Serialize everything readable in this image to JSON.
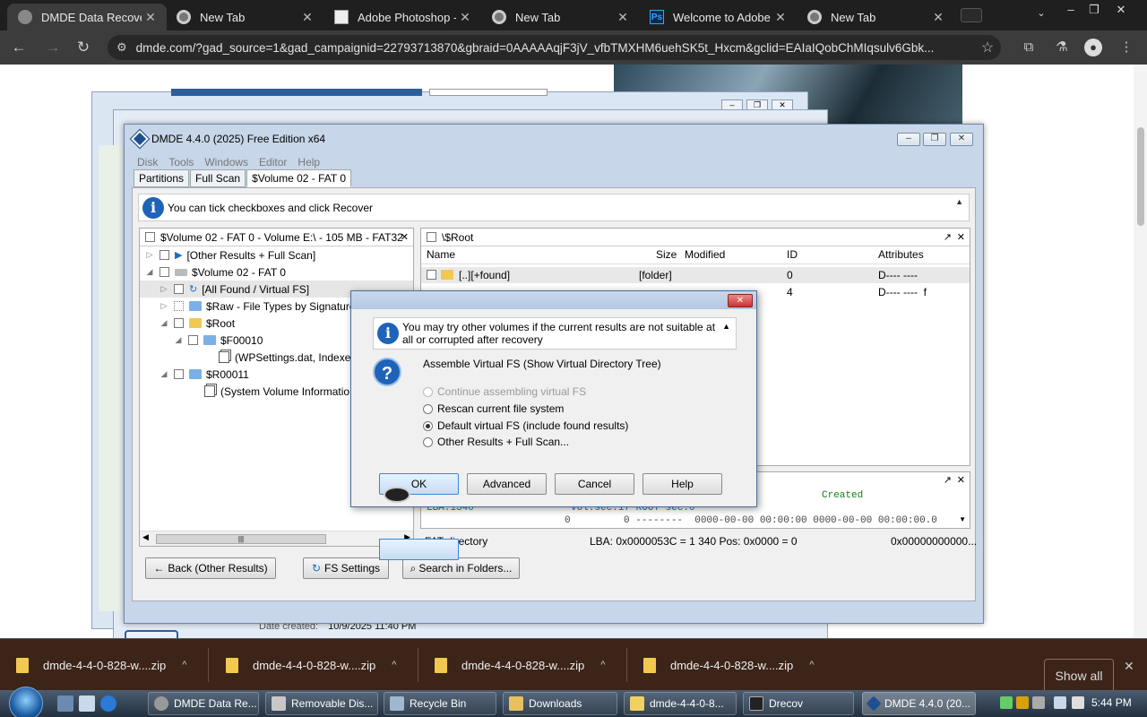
{
  "browser": {
    "tabs": [
      {
        "label": "DMDE Data Recovery",
        "icon": "dmde-icon",
        "active": true
      },
      {
        "label": "New Tab",
        "icon": "chrome-icon"
      },
      {
        "label": "Adobe Photoshop - ",
        "icon": "photoshop-icon"
      },
      {
        "label": "New Tab",
        "icon": "chrome-icon"
      },
      {
        "label": "Welcome to Adobe",
        "icon": "ps-icon",
        "icon_text": "Ps"
      },
      {
        "label": "New Tab",
        "icon": "chrome-icon"
      }
    ],
    "url": "dmde.com/?gad_source=1&gad_campaignid=22793713870&gbraid=0AAAAAqjF3jV_vfbTMXHM6uehSK5t_Hxcm&gclid=EAIaIQobChMIqsulv6Gbk..."
  },
  "page": {
    "date_created_label": "Date created:",
    "date_created_value": "10/9/2025 11:40 PM"
  },
  "dmde": {
    "title": "DMDE 4.4.0 (2025) Free Edition x64",
    "menu": [
      "Disk",
      "Tools",
      "Windows",
      "Editor",
      "Help"
    ],
    "tabs": [
      "Partitions",
      "Full Scan",
      "$Volume 02 - FAT 0"
    ],
    "info_text": "You can tick checkboxes and click Recover",
    "left_pane_title": "$Volume 02 - FAT 0 - Volume E:\\ - 105 MB - FAT32",
    "tree": [
      "[Other Results + Full Scan]",
      "$Volume 02 - FAT 0",
      "[All Found / Virtual FS]",
      "$Raw - File Types by Signature",
      "$Root",
      "$F00010",
      "(WPSettings.dat, Indexer",
      "$R00011",
      "(System Volume Informatio"
    ],
    "right_pane_title": "\\$Root",
    "columns": {
      "name": "Name",
      "size": "Size",
      "modified": "Modified",
      "id": "ID",
      "attributes": "Attributes"
    },
    "rows": [
      {
        "name": "[..][+found]",
        "size": "[folder]",
        "id": "0",
        "attr": "D---- ----"
      },
      {
        "name": "",
        "size": "",
        "id": "4",
        "attr": "D---- ----  f"
      }
    ],
    "lower_pane": {
      "created_label": "Created",
      "lba_line": "LBA:1340",
      "vol_line": "vol.sec:17 ROOT sec:0",
      "data_line": "0         0 --------  0000-00-00 00:00:00 0000-00-00 00:00:00.0"
    },
    "status": {
      "left": "FAT directory",
      "mid": "LBA: 0x0000053C = 1 340  Pos: 0x0000 = 0",
      "right": "0x00000000000..."
    },
    "buttons": {
      "back": "Back (Other Results)",
      "fs_settings": "FS Settings",
      "search": "Search in Folders..."
    }
  },
  "dialog": {
    "info_text": "You may try other volumes if the current results are not suitable at all or corrupted after recovery",
    "heading": "Assemble Virtual FS (Show Virtual Directory Tree)",
    "options": [
      {
        "label": "Continue assembling virtual FS",
        "disabled": true,
        "selected": false
      },
      {
        "label": "Rescan current file system",
        "disabled": false,
        "selected": false
      },
      {
        "label": "Default virtual FS (include found results)",
        "disabled": false,
        "selected": true
      },
      {
        "label": "Other Results + Full Scan...",
        "disabled": false,
        "selected": false
      }
    ],
    "buttons": {
      "ok": "OK",
      "advanced": "Advanced",
      "cancel": "Cancel",
      "help": "Help"
    }
  },
  "downloads": {
    "items": [
      "dmde-4-4-0-828-w....zip",
      "dmde-4-4-0-828-w....zip",
      "dmde-4-4-0-828-w....zip",
      "dmde-4-4-0-828-w....zip"
    ],
    "show_all": "Show all"
  },
  "taskbar": {
    "tasks": [
      "DMDE Data Re...",
      "Removable Dis...",
      "Recycle Bin",
      "Downloads",
      "dmde-4-4-0-8...",
      "Drecov",
      "DMDE 4.4.0 (20..."
    ],
    "clock": "5:44 PM"
  },
  "colors": {
    "tab_bar": "#1f1f1f",
    "toolbar": "#3c3c3c",
    "downloads_bar": "#3c2418",
    "accent_blue": "#1e63b8"
  }
}
